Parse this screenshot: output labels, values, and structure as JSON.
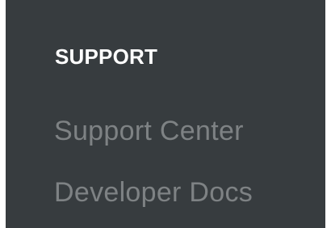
{
  "footer": {
    "section_title": "SUPPORT",
    "links": [
      {
        "label": "Support Center"
      },
      {
        "label": "Developer Docs"
      }
    ]
  },
  "colors": {
    "background": "#373c3f",
    "heading": "#ffffff",
    "link": "#7e8284"
  }
}
